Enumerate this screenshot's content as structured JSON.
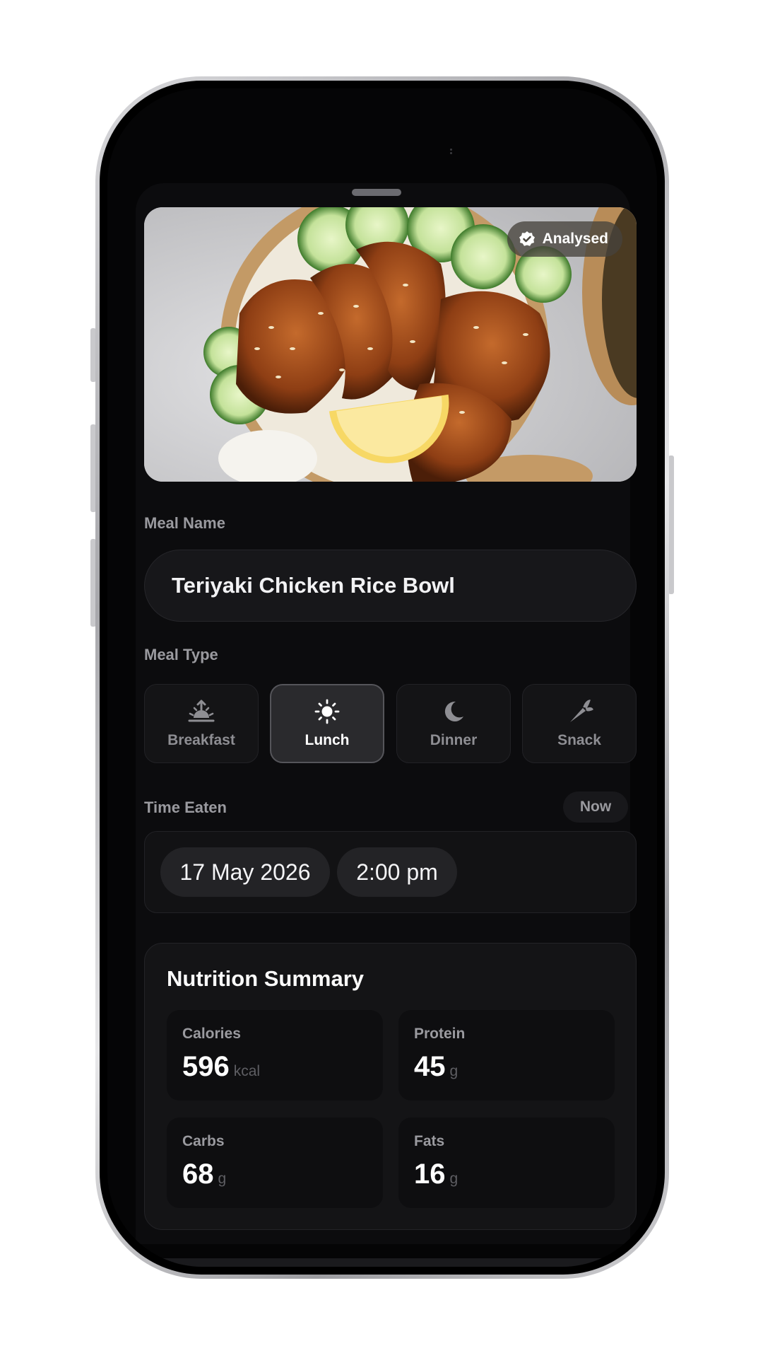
{
  "photo": {
    "badge_label": "Analysed",
    "badge_icon": "check-badge-icon"
  },
  "meal_name": {
    "label": "Meal Name",
    "value": "Teriyaki Chicken Rice Bowl"
  },
  "meal_type": {
    "label": "Meal Type",
    "selected": "Lunch",
    "options": [
      {
        "label": "Breakfast",
        "icon": "sunrise-icon"
      },
      {
        "label": "Lunch",
        "icon": "sun-icon"
      },
      {
        "label": "Dinner",
        "icon": "moon-icon"
      },
      {
        "label": "Snack",
        "icon": "carrot-icon"
      }
    ]
  },
  "time_eaten": {
    "label": "Time Eaten",
    "now_label": "Now",
    "date": "17 May 2026",
    "time": "2:00 pm"
  },
  "nutrition": {
    "title": "Nutrition Summary",
    "items": [
      {
        "label": "Calories",
        "value": "596",
        "unit": "kcal"
      },
      {
        "label": "Protein",
        "value": "45",
        "unit": "g"
      },
      {
        "label": "Carbs",
        "value": "68",
        "unit": "g"
      },
      {
        "label": "Fats",
        "value": "16",
        "unit": "g"
      }
    ]
  },
  "colors": {
    "background": "#050506",
    "card": "#141416",
    "selected_border": "#55555a",
    "accent_text": "#ffffff"
  }
}
